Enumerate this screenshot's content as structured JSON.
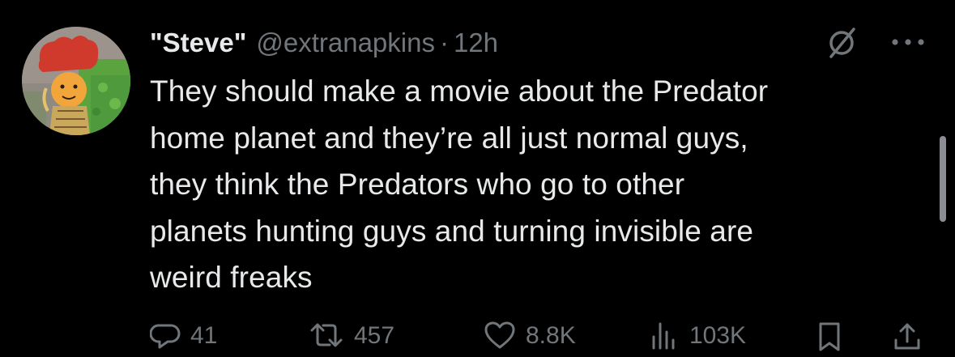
{
  "tweet": {
    "display_name": "\"Steve\"",
    "handle": "@extranapkins",
    "separator": "·",
    "time": "12h",
    "text": "They should make a movie about the Predator\nhome planet and they’re all just normal guys,\nthey think the Predators who go to other\nplanets hunting guys and turning invisible are\nweird freaks"
  },
  "icons": {
    "avatar": "avatar-illustration",
    "grok": "grok-icon",
    "more": "more-icon",
    "reply": "reply-icon",
    "retweet": "retweet-icon",
    "like": "heart-icon",
    "views": "views-icon",
    "bookmark": "bookmark-icon",
    "share": "share-icon"
  },
  "actions": {
    "reply_count": "41",
    "retweet_count": "457",
    "like_count": "8.8K",
    "views_count": "103K"
  },
  "colors": {
    "background": "#000000",
    "primary_text": "#e7e9ea",
    "secondary_text": "#71767b",
    "avatar_hat": "#d03a2c",
    "avatar_face": "#f2a53a",
    "avatar_grass": "#5aa33f"
  }
}
